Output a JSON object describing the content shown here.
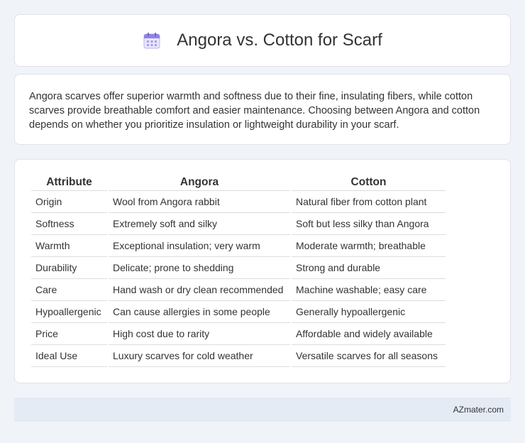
{
  "header": {
    "icon": "calendar-icon",
    "title": "Angora vs. Cotton for Scarf"
  },
  "intro": {
    "text": "Angora scarves offer superior warmth and softness due to their fine, insulating fibers, while cotton scarves provide breathable comfort and easier maintenance. Choosing between Angora and cotton depends on whether you prioritize insulation or lightweight durability in your scarf."
  },
  "table": {
    "headers": [
      "Attribute",
      "Angora",
      "Cotton"
    ],
    "rows": [
      [
        "Origin",
        "Wool from Angora rabbit",
        "Natural fiber from cotton plant"
      ],
      [
        "Softness",
        "Extremely soft and silky",
        "Soft but less silky than Angora"
      ],
      [
        "Warmth",
        "Exceptional insulation; very warm",
        "Moderate warmth; breathable"
      ],
      [
        "Durability",
        "Delicate; prone to shedding",
        "Strong and durable"
      ],
      [
        "Care",
        "Hand wash or dry clean recommended",
        "Machine washable; easy care"
      ],
      [
        "Hypoallergenic",
        "Can cause allergies in some people",
        "Generally hypoallergenic"
      ],
      [
        "Price",
        "High cost due to rarity",
        "Affordable and widely available"
      ],
      [
        "Ideal Use",
        "Luxury scarves for cold weather",
        "Versatile scarves for all seasons"
      ]
    ]
  },
  "footer": {
    "text": "AZmater.com"
  }
}
